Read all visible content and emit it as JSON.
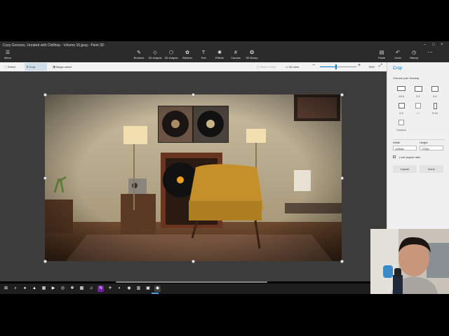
{
  "window": {
    "title": "Cozy Grooves, Unrated with Chillhop - Volume 16.jpeg - Paint 3D",
    "controls": [
      "–",
      "□",
      "×"
    ]
  },
  "ribbon": {
    "menu_label": "Menu",
    "items": [
      {
        "label": "Brushes",
        "icon": "brush-icon",
        "glyph": "✎"
      },
      {
        "label": "2D shapes",
        "icon": "2d-shapes-icon",
        "glyph": "◇"
      },
      {
        "label": "3D shapes",
        "icon": "3d-shapes-icon",
        "glyph": "⬡"
      },
      {
        "label": "Stickers",
        "icon": "stickers-icon",
        "glyph": "✿"
      },
      {
        "label": "Text",
        "icon": "text-icon",
        "glyph": "T"
      },
      {
        "label": "Effects",
        "icon": "effects-icon",
        "glyph": "✺"
      },
      {
        "label": "Canvas",
        "icon": "canvas-icon",
        "glyph": "#"
      },
      {
        "label": "3D library",
        "icon": "3d-library-icon",
        "glyph": "✪"
      }
    ],
    "right_items": [
      {
        "label": "Paste",
        "icon": "paste-icon",
        "glyph": "▤"
      },
      {
        "label": "Undo",
        "icon": "undo-icon",
        "glyph": "↶"
      },
      {
        "label": "History",
        "icon": "history-icon",
        "glyph": "◷"
      },
      {
        "label": "",
        "icon": "more-icon",
        "glyph": "⋯"
      }
    ]
  },
  "toolbar": {
    "select": "Select",
    "crop": "Crop",
    "magic_select": "Magic select",
    "mixed_reality": "Mixed reality",
    "view_3d": "3D view",
    "zoom_level": "99%",
    "zoom_fraction": 0.45
  },
  "panel": {
    "title": "Crop",
    "choose_framing": "Choose your framing",
    "options": [
      "16:9",
      "3:2",
      "5:4",
      "4:3",
      "1:1",
      "9:16"
    ],
    "custom": "Custom",
    "width_label": "Width",
    "height_label": "Height",
    "width_value": "1280px",
    "height_value": "720px",
    "lock_aspect": "Lock aspect ratio",
    "cancel": "Cancel",
    "done": "Done"
  },
  "taskbar": {
    "icons": [
      {
        "name": "windows-start-icon",
        "glyph": "⊞",
        "color": "#1e1e1e"
      },
      {
        "name": "search-icon",
        "glyph": "⌕",
        "color": "#1e1e1e"
      },
      {
        "name": "chrome-icon",
        "glyph": "●",
        "color": "#1e1e1e"
      },
      {
        "name": "app-icon",
        "glyph": "▲",
        "color": "#1e1e1e"
      },
      {
        "name": "file-explorer-icon",
        "glyph": "▦",
        "color": "#1e1e1e"
      },
      {
        "name": "youtube-icon",
        "glyph": "▶",
        "color": "#1e1e1e"
      },
      {
        "name": "app-icon",
        "glyph": "◎",
        "color": "#1e1e1e"
      },
      {
        "name": "app-icon",
        "glyph": "❖",
        "color": "#1e1e1e"
      },
      {
        "name": "app-icon",
        "glyph": "▩",
        "color": "#1e1e1e"
      },
      {
        "name": "app-icon",
        "glyph": "♫",
        "color": "#1e1e1e"
      },
      {
        "name": "onenote-icon",
        "glyph": "N",
        "color": "#7719aa"
      },
      {
        "name": "app-icon",
        "glyph": "✈",
        "color": "#1e1e1e"
      },
      {
        "name": "edge-icon",
        "glyph": "◐",
        "color": "#1e1e1e"
      },
      {
        "name": "app-icon",
        "glyph": "◉",
        "color": "#1e1e1e"
      },
      {
        "name": "app-icon",
        "glyph": "▥",
        "color": "#1e1e1e"
      },
      {
        "name": "app-icon",
        "glyph": "▣",
        "color": "#1e1e1e"
      },
      {
        "name": "paint-3d-icon",
        "glyph": "◆",
        "color": "#444"
      }
    ]
  },
  "colors": {
    "accent": "#0078d4",
    "toolbar_active": "#cfdde9",
    "canvas_bg": "#3c3c3c"
  }
}
